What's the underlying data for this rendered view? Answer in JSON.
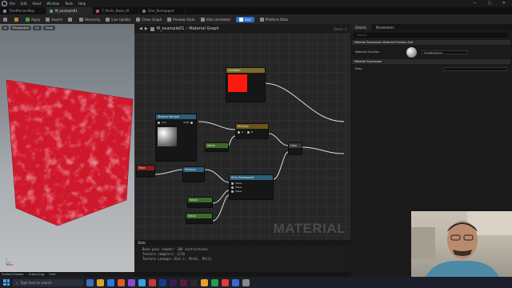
{
  "menu": {
    "items": [
      "File",
      "Edit",
      "Asset",
      "Window",
      "Tools",
      "Help"
    ]
  },
  "tabs": [
    {
      "label": "ThirdPersonMap",
      "active": false
    },
    {
      "label": "M_example01",
      "active": true
    },
    {
      "label": "T_Perlin_Noise_M",
      "active": false
    },
    {
      "label": "Sine_Remapped",
      "active": false
    }
  ],
  "toolbar": {
    "apply": "Apply",
    "search": "Search",
    "hierarchy": "Hierarchy",
    "live_update": "Live Update",
    "clean_graph": "Clean Graph",
    "preview_state": "Preview State",
    "hide_unrelated": "Hide Unrelated",
    "live": "Live",
    "platform_stats": "Platform Stats"
  },
  "viewport": {
    "perspective": "Perspective",
    "lit": "Lit",
    "show": "Show"
  },
  "graph": {
    "breadcrumb_root": "M_example01",
    "breadcrumb_child": "Material Graph",
    "zoom": "Zoom -1",
    "watermark": "MATERIAL",
    "nodes": {
      "constant_title": "Constant",
      "texture_title": "Texture Sample",
      "multiply_title": "Multiply",
      "time_title": "Time",
      "sine_title": "Sine_Remapped",
      "lerp_title": "Lerp",
      "input_value": "Value"
    }
  },
  "details": {
    "tab_details": "Details",
    "tab_parameters": "Parameters",
    "search_placeholder": "Search",
    "section_function": "Material Expression Material Function Call",
    "material_function_label": "Material Function",
    "material_function_value": "SineRemapped",
    "section_expression": "Material Expression",
    "desc_label": "Desc"
  },
  "stats": {
    "header": "Stats",
    "lines": [
      "Base pass shader: 204 instructions",
      "Texture samplers: 3/16",
      "Texture Lookups (Est.): VS(0), PS(1)"
    ]
  },
  "bottom": {
    "content_drawer": "Content Drawer",
    "output_log": "Output Log",
    "cmd": "Cmd"
  },
  "taskbar": {
    "search_placeholder": "Type here to search"
  },
  "colors": {
    "accent": "#2d6ec9",
    "material": "#d0182c"
  }
}
